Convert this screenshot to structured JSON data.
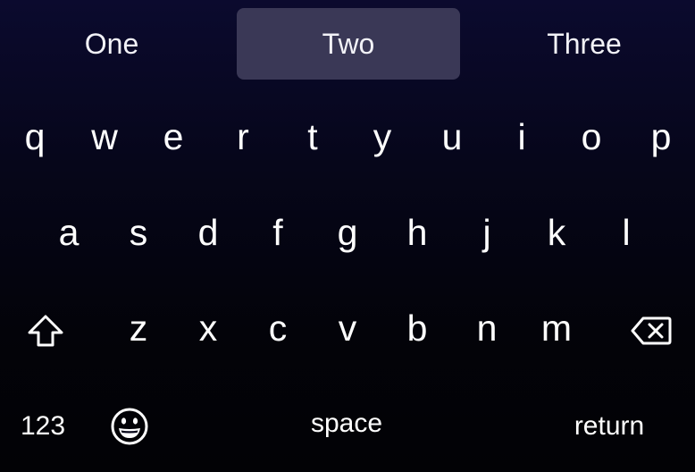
{
  "suggestions": [
    "One",
    "Two",
    "Three"
  ],
  "rows": {
    "top": [
      "q",
      "w",
      "e",
      "r",
      "t",
      "y",
      "u",
      "i",
      "o",
      "p"
    ],
    "middle": [
      "a",
      "s",
      "d",
      "f",
      "g",
      "h",
      "j",
      "k",
      "l"
    ],
    "bottom": [
      "z",
      "x",
      "c",
      "v",
      "b",
      "n",
      "m"
    ]
  },
  "keys": {
    "numbers": "123",
    "space": "space",
    "return": "return"
  },
  "icons": {
    "shift": "shift-arrow-icon",
    "delete": "backspace-icon",
    "emoji": "emoji-face-icon"
  },
  "colors": {
    "selected_suggestion": "#3a3856",
    "key_text": "#ffffff"
  }
}
